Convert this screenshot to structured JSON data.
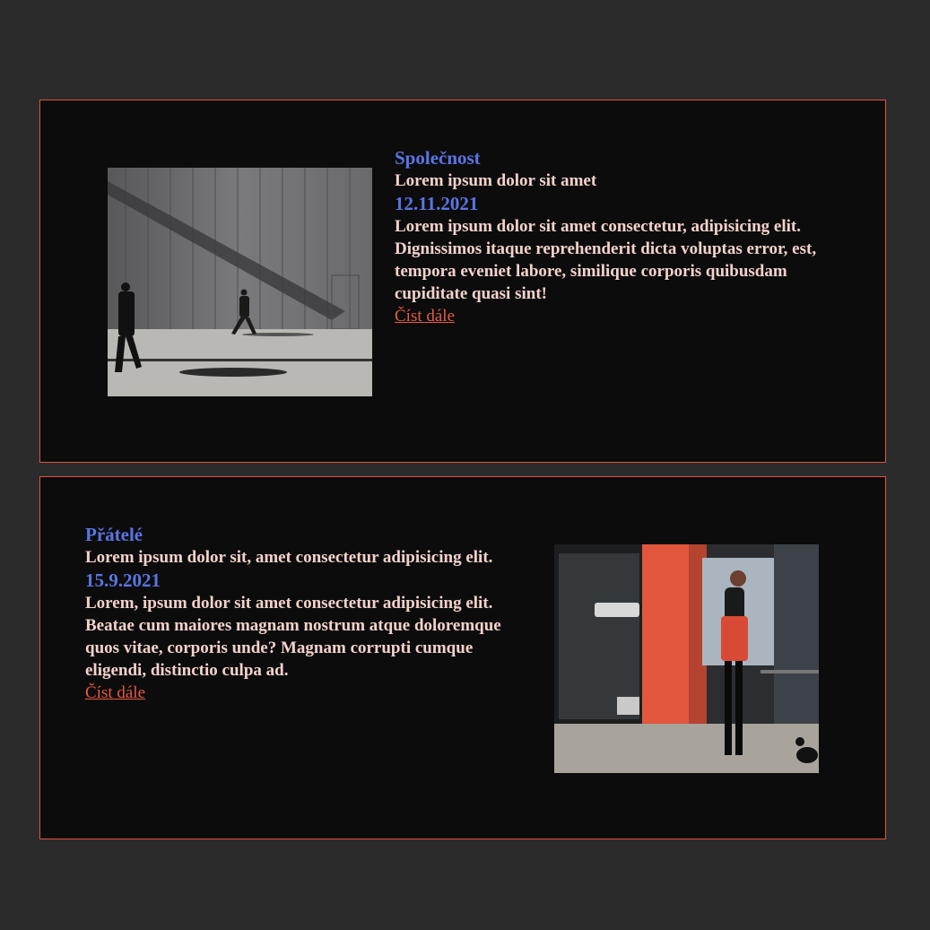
{
  "articles": [
    {
      "category": "Společnost",
      "title": "Lorem ipsum dolor sit amet",
      "date": "12.11.2021",
      "excerpt": "Lorem ipsum dolor sit amet consectetur, adipisicing elit. Dignissimos itaque reprehenderit dicta voluptas error, est, tempora eveniet labore, similique corporis quibusdam cupiditate quasi sint!",
      "read_more": "Číst dále"
    },
    {
      "category": "Přátelé",
      "title": "Lorem ipsum dolor sit, amet consectetur adipisicing elit.",
      "date": "15.9.2021",
      "excerpt": "Lorem, ipsum dolor sit amet consectetur adipisicing elit. Beatae cum maiores magnam nostrum atque doloremque quos vitae, corporis unde? Magnam corrupti cumque eligendi, distinctio culpa ad.",
      "read_more": "Číst dále"
    }
  ],
  "colors": {
    "page_background": "#2b2b2b",
    "card_background": "#0c0c0c",
    "card_border": "#e0523b",
    "accent_blue": "#5a75e3",
    "link": "#e85a43",
    "text": "#f4d2cc"
  }
}
